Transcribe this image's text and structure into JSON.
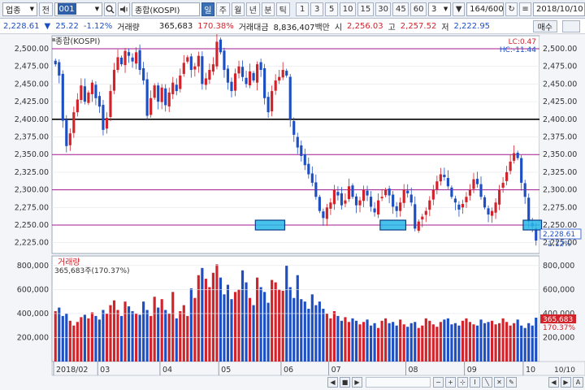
{
  "toolbar": {
    "market_select": "업종",
    "ctx_button": "전",
    "code": "001",
    "name": "종합(KOSPI)",
    "periods": [
      "일",
      "주",
      "월",
      "년",
      "분",
      "틱"
    ],
    "active_period": "일",
    "intervals": [
      "1",
      "3",
      "5",
      "10",
      "15",
      "30",
      "45",
      "60"
    ],
    "interval_value": "3",
    "count": "164/600",
    "date": "2018/10/10"
  },
  "quote": {
    "price": "2,228.61",
    "change": "25.22",
    "change_pct": "-1.12%",
    "volume_label": "거래량",
    "volume": "365,683",
    "volume_ratio": "170.38%",
    "amount_label": "거래대금",
    "amount": "8,836,407백만",
    "open_label": "시",
    "open": "2,256.03",
    "high_label": "고",
    "high": "2,257.52",
    "low_label": "저",
    "low": "2,222.95",
    "buy_label": "매수"
  },
  "price_panel": {
    "title": "종합(KOSPI)",
    "lc": "LC:0.47",
    "hc": "HC:-11.44",
    "ticks": [
      "2,500.00",
      "2,475.00",
      "2,450.00",
      "2,425.00",
      "2,400.00",
      "2,375.00",
      "2,350.00",
      "2,325.00",
      "2,300.00",
      "2,275.00",
      "2,250.00",
      "2,225.00"
    ],
    "last_price_tag": "2,228.61",
    "last_change_tag": "-1.12%"
  },
  "volume_panel": {
    "title": "거래량",
    "info": "365,683주(170.37%)",
    "ticks": [
      "800,000",
      "600,000",
      "400,000",
      "200,000"
    ],
    "last_tag": "365,683",
    "ratio_tag": "170.37%"
  },
  "x_axis": {
    "labels": [
      "2018/02",
      "03",
      "04",
      "05",
      "06",
      "07",
      "08",
      "09",
      "10"
    ],
    "end_label": "10/10"
  },
  "colors": {
    "up": "#d2222a",
    "down": "#1d4fc4",
    "hline": "#a0188f",
    "bold_line": "#000000"
  },
  "chart_data": {
    "type": "candlestick",
    "title": "종합(KOSPI)",
    "ylim": [
      2212,
      2515
    ],
    "horizontal_lines": [
      2500,
      2400,
      2350,
      2300,
      2250
    ],
    "support_boxes": [
      {
        "start_index": 55,
        "end_index": 62,
        "price": 2250
      },
      {
        "start_index": 89,
        "end_index": 95,
        "price": 2250
      },
      {
        "start_index": 128,
        "end_index": 132,
        "price": 2250
      }
    ],
    "closes": [
      2478,
      2462,
      2398,
      2362,
      2380,
      2410,
      2428,
      2448,
      2425,
      2438,
      2452,
      2430,
      2418,
      2385,
      2402,
      2440,
      2470,
      2488,
      2478,
      2497,
      2490,
      2482,
      2495,
      2470,
      2455,
      2405,
      2430,
      2448,
      2425,
      2445,
      2420,
      2438,
      2452,
      2440,
      2462,
      2480,
      2488,
      2470,
      2475,
      2490,
      2450,
      2458,
      2470,
      2478,
      2510,
      2495,
      2470,
      2452,
      2440,
      2465,
      2475,
      2460,
      2450,
      2468,
      2455,
      2478,
      2470,
      2430,
      2410,
      2440,
      2455,
      2460,
      2470,
      2462,
      2400,
      2378,
      2360,
      2348,
      2335,
      2322,
      2310,
      2290,
      2270,
      2260,
      2275,
      2282,
      2300,
      2292,
      2278,
      2285,
      2305,
      2290,
      2278,
      2285,
      2300,
      2292,
      2276,
      2268,
      2285,
      2290,
      2300,
      2292,
      2276,
      2270,
      2282,
      2300,
      2295,
      2282,
      2245,
      2255,
      2262,
      2270,
      2285,
      2300,
      2312,
      2322,
      2318,
      2305,
      2290,
      2282,
      2272,
      2280,
      2290,
      2300,
      2315,
      2308,
      2290,
      2275,
      2265,
      2270,
      2282,
      2300,
      2310,
      2325,
      2340,
      2352,
      2345,
      2310,
      2290,
      2255,
      2248,
      2228
    ],
    "volumes": [
      420000,
      450000,
      380000,
      400000,
      340000,
      300000,
      330000,
      370000,
      390000,
      360000,
      410000,
      380000,
      350000,
      430000,
      400000,
      470000,
      510000,
      430000,
      380000,
      500000,
      460000,
      420000,
      400000,
      390000,
      500000,
      430000,
      380000,
      540000,
      450000,
      520000,
      430000,
      400000,
      580000,
      360000,
      420000,
      470000,
      380000,
      610000,
      530000,
      720000,
      780000,
      690000,
      620000,
      740000,
      810000,
      700000,
      560000,
      640000,
      520000,
      580000,
      600000,
      760000,
      660000,
      530000,
      470000,
      700000,
      620000,
      580000,
      490000,
      680000,
      660000,
      600000,
      590000,
      800000,
      620000,
      530000,
      720000,
      520000,
      500000,
      440000,
      560000,
      470000,
      500000,
      440000,
      400000,
      360000,
      420000,
      380000,
      340000,
      370000,
      330000,
      360000,
      340000,
      310000,
      330000,
      350000,
      300000,
      320000,
      280000,
      340000,
      360000,
      320000,
      330000,
      300000,
      350000,
      310000,
      290000,
      320000,
      330000,
      280000,
      300000,
      360000,
      340000,
      310000,
      290000,
      330000,
      350000,
      360000,
      310000,
      320000,
      300000,
      340000,
      360000,
      330000,
      310000,
      300000,
      350000,
      320000,
      330000,
      340000,
      310000,
      320000,
      360000,
      330000,
      300000,
      320000,
      350000,
      300000,
      280000,
      320000,
      300000,
      365683
    ]
  }
}
